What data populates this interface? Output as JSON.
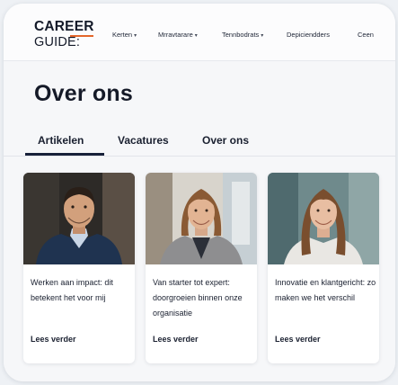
{
  "brand": {
    "line1": "CAREER",
    "line2": "GUIDE:",
    "accent_color": "#e4662b"
  },
  "nav": {
    "items": [
      {
        "label": "Kerten",
        "has_dropdown": true
      },
      {
        "label": "Mrravtarare",
        "has_dropdown": true
      },
      {
        "label": "Tennbodrats",
        "has_dropdown": true
      },
      {
        "label": "Depiciendders",
        "has_dropdown": false
      },
      {
        "label": "Ceen",
        "has_dropdown": false
      }
    ],
    "caret": "▾"
  },
  "page": {
    "title": "Over ons"
  },
  "tabs": [
    {
      "label": "Artikelen",
      "active": true
    },
    {
      "label": "Vacatures",
      "active": false
    },
    {
      "label": "Over ons",
      "active": false
    }
  ],
  "articles": [
    {
      "title": "Werken aan impact: dit betekent het voor mij",
      "link": "Lees verder",
      "photo": "smiling-man-portrait"
    },
    {
      "title": "Van starter tot expert: doorgroeien binnen onze organisatie",
      "link": "Lees verder",
      "photo": "smiling-woman-portrait"
    },
    {
      "title": "Innovatie en klantgericht: zo maken we het verschil",
      "link": "Lees verder",
      "photo": "smiling-woman-long-hair-portrait"
    }
  ],
  "colors": {
    "text": "#1a2030",
    "tab_underline": "#18213a",
    "page_bg": "#f6f7f9"
  }
}
